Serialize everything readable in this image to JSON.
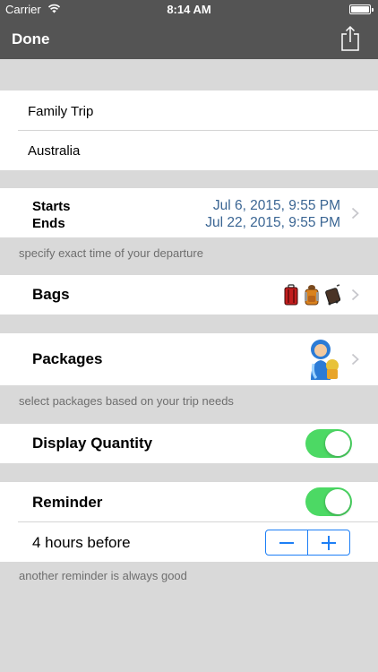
{
  "status_bar": {
    "carrier": "Carrier",
    "time": "8:14 AM",
    "wifi_icon": "wifi-icon",
    "battery_icon": "battery-icon"
  },
  "nav": {
    "done_label": "Done",
    "share_icon": "share-icon"
  },
  "trip": {
    "name": "Family Trip",
    "destination": "Australia"
  },
  "dates": {
    "starts_label": "Starts",
    "ends_label": "Ends",
    "starts_value": "Jul 6, 2015, 9:55 PM",
    "ends_value": "Jul 22, 2015, 9:55 PM",
    "footer": "specify exact time of your departure"
  },
  "bags": {
    "label": "Bags",
    "icons": [
      "red-suitcase-icon",
      "backpack-icon",
      "rolling-bag-icon"
    ]
  },
  "packages": {
    "label": "Packages",
    "icon": "traveler-icon",
    "footer": "select packages based on your trip needs"
  },
  "display_quantity": {
    "label": "Display Quantity",
    "enabled": true
  },
  "reminder": {
    "label": "Reminder",
    "enabled": true,
    "value": "4 hours before",
    "footer": "another reminder is always good",
    "minus_icon": "minus-icon",
    "plus_icon": "plus-icon"
  },
  "colors": {
    "bar": "#545454",
    "accent": "#1d7ff6",
    "switch_on": "#4cd964",
    "date_text": "#3a6593",
    "background": "#d9d9d9"
  }
}
